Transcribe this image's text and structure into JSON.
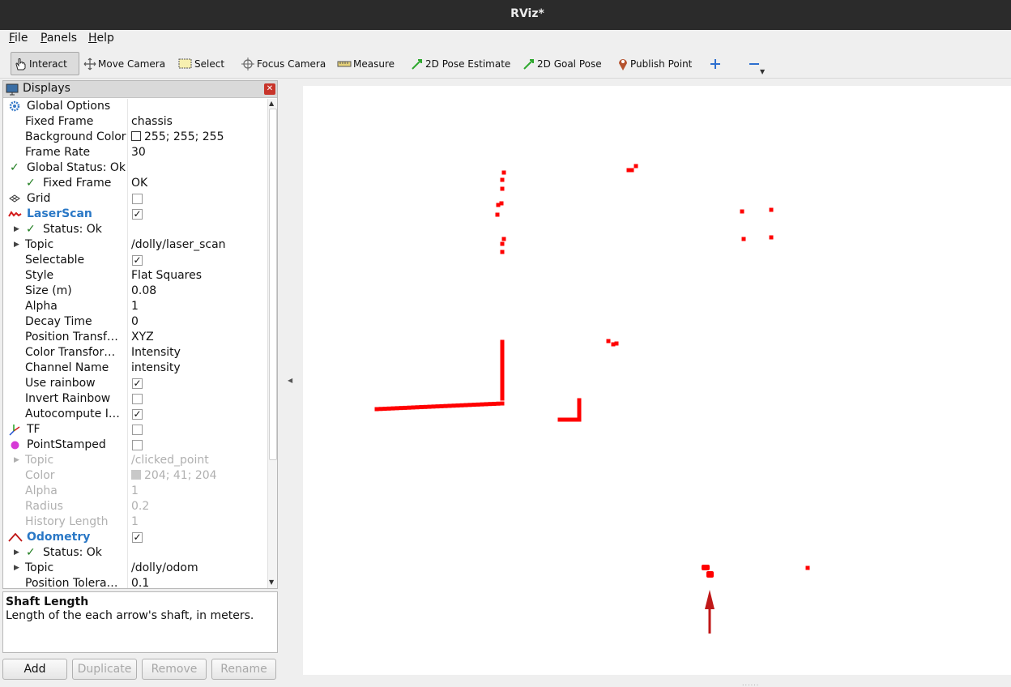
{
  "window": {
    "title": "RViz*"
  },
  "menubar": {
    "file": {
      "accel": "F",
      "rest": "ile"
    },
    "panels": {
      "accel": "P",
      "rest": "anels"
    },
    "help": {
      "accel": "H",
      "rest": "elp"
    }
  },
  "toolbar": {
    "interact": "Interact",
    "move_camera": "Move Camera",
    "select": "Select",
    "focus_camera": "Focus Camera",
    "measure": "Measure",
    "pose_estimate": "2D Pose Estimate",
    "goal_pose": "2D Goal Pose",
    "publish_point": "Publish Point",
    "add_tool_icon": "plus-icon",
    "remove_tool_icon": "minus-icon"
  },
  "displays_panel": {
    "title": "Displays",
    "rows": [
      {
        "name": "Global Options",
        "value": ""
      },
      {
        "name": "Fixed Frame",
        "value": "chassis"
      },
      {
        "name": "Background Color",
        "value": "255; 255; 255"
      },
      {
        "name": "Frame Rate",
        "value": "30"
      },
      {
        "name": "Global Status: Ok",
        "value": ""
      },
      {
        "name": "Fixed Frame",
        "value": "OK"
      },
      {
        "name": "Grid",
        "value": ""
      },
      {
        "name": "LaserScan",
        "value": ""
      },
      {
        "name": "Status: Ok",
        "value": ""
      },
      {
        "name": "Topic",
        "value": "/dolly/laser_scan"
      },
      {
        "name": "Selectable",
        "value": ""
      },
      {
        "name": "Style",
        "value": "Flat Squares"
      },
      {
        "name": "Size (m)",
        "value": "0.08"
      },
      {
        "name": "Alpha",
        "value": "1"
      },
      {
        "name": "Decay Time",
        "value": "0"
      },
      {
        "name": "Position Transf…",
        "value": "XYZ"
      },
      {
        "name": "Color Transfor…",
        "value": "Intensity"
      },
      {
        "name": "Channel Name",
        "value": "intensity"
      },
      {
        "name": "Use rainbow",
        "value": ""
      },
      {
        "name": "Invert Rainbow",
        "value": ""
      },
      {
        "name": "Autocompute I…",
        "value": ""
      },
      {
        "name": "TF",
        "value": ""
      },
      {
        "name": "PointStamped",
        "value": ""
      },
      {
        "name": "Topic",
        "value": "/clicked_point"
      },
      {
        "name": "Color",
        "value": "204; 41; 204"
      },
      {
        "name": "Alpha",
        "value": "1"
      },
      {
        "name": "Radius",
        "value": "0.2"
      },
      {
        "name": "History Length",
        "value": "1"
      },
      {
        "name": "Odometry",
        "value": ""
      },
      {
        "name": "Status: Ok",
        "value": ""
      },
      {
        "name": "Topic",
        "value": "/dolly/odom"
      },
      {
        "name": "Position Tolera…",
        "value": "0.1"
      }
    ],
    "check_mark": "✓",
    "checkboxes": {
      "grid": false,
      "laserscan": true,
      "selectable": true,
      "use_rainbow": true,
      "invert_rainbow": false,
      "autocompute": true,
      "tf": false,
      "pointstamped": false,
      "odometry": true
    },
    "colors": {
      "background_swatch": "#ffffff",
      "point_color_swatch": "#cc29cc",
      "odometry_arrow": "#c01818"
    }
  },
  "description": {
    "title": "Shaft Length",
    "text": "Length of the each arrow's shaft, in meters."
  },
  "buttons": {
    "add": "Add",
    "duplicate": "Duplicate",
    "remove": "Remove",
    "rename": "Rename"
  },
  "viewport": {
    "background_color": "#ffffff",
    "laser_color": "#ff0000",
    "style": "Flat Squares"
  }
}
